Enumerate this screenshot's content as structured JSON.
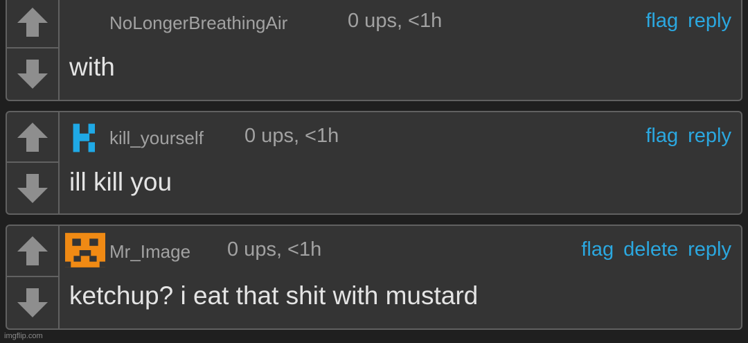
{
  "comments": [
    {
      "username": "NoLongerBreathingAir",
      "meta": "0 ups, <1h",
      "body": "with",
      "avatar": "none",
      "actions": [
        "flag",
        "reply"
      ]
    },
    {
      "username": "kill_yourself",
      "meta": "0 ups, <1h",
      "body": "ill kill you",
      "avatar": "blue-k-logo-icon",
      "actions": [
        "flag",
        "reply"
      ]
    },
    {
      "username": "Mr_Image",
      "meta": "0 ups, <1h",
      "body": "ketchup? i eat that shit with mustard",
      "avatar": "orange-pixel-face-icon",
      "actions": [
        "flag",
        "delete",
        "reply"
      ]
    }
  ],
  "watermark": "imgflip.com",
  "colors": {
    "background": "#1f1f1f",
    "panel": "#343434",
    "border": "#616161",
    "link": "#2ba8e0",
    "meta_text": "#a2a2a2",
    "body_text": "#e4e4e4",
    "k_logo": "#1fa9e6",
    "pixel_face": "#f08a14"
  }
}
